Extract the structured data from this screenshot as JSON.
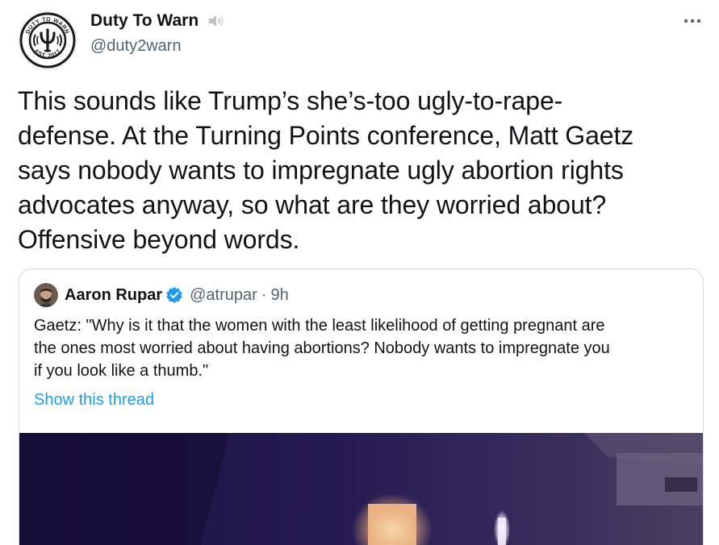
{
  "author": {
    "name": "Duty To Warn",
    "handle": "@duty2warn",
    "avatar_text_top": "DUTY TO WARN",
    "avatar_text_bottom": "EST. 2017",
    "avatar_icon": "psi-badge-logo"
  },
  "header_icons": {
    "speaker": "speaker-icon",
    "more": "more-icon"
  },
  "tweet": {
    "text": "This sounds like Trump’s she’s-too ugly-to-rape-\ndefense. At the Turning Points conference, Matt Gaetz\nsays nobody wants to impregnate ugly abortion rights\nadvocates anyway, so what are they worried about?\nOffensive beyond words."
  },
  "quote": {
    "name": "Aaron Rupar",
    "verified_icon": "verified-badge-icon",
    "handle": "@atrupar",
    "separator": "·",
    "time": "9h",
    "text": "Gaetz: \"Why is it that the women with the least likelihood of getting pregnant are\nthe ones most worried about having abortions? Nobody wants to impregnate you\nif you look like a thumb.\"",
    "show_thread": "Show this thread"
  },
  "colors": {
    "text_primary": "#0f1419",
    "text_secondary": "#536471",
    "link": "#1d9bf0",
    "border": "#cfd9de",
    "verified": "#1d9bf0"
  }
}
